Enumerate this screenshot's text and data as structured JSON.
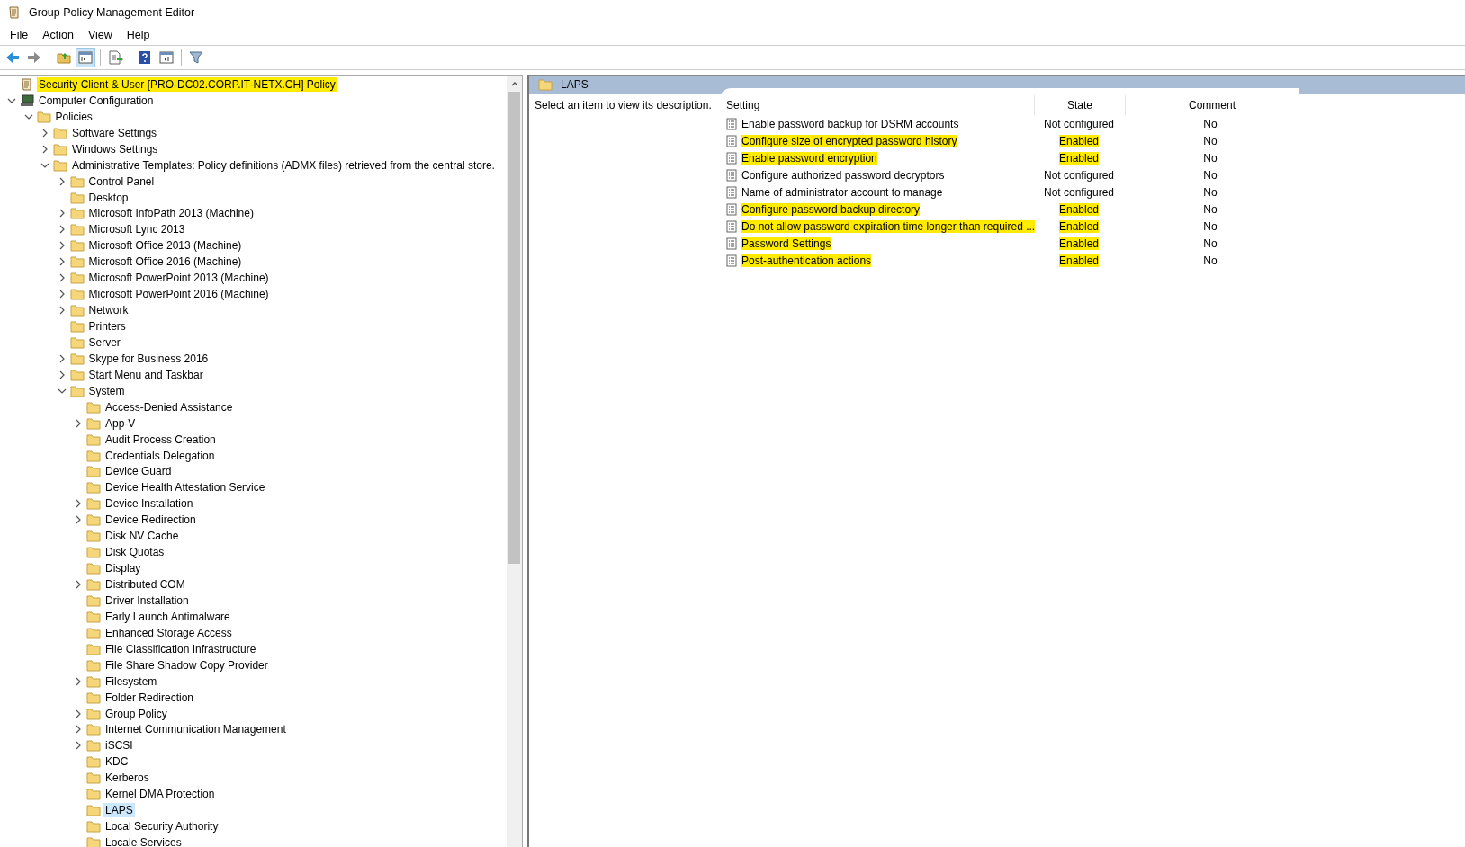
{
  "window": {
    "title": "Group Policy Management Editor"
  },
  "menu": [
    "File",
    "Action",
    "View",
    "Help"
  ],
  "toolbar": {
    "console_tree_pressed": true
  },
  "tree": [
    {
      "label": "Security Client & User [PRO-DC02.CORP.IT-NETX.CH] Policy",
      "kind": "policy",
      "highlighted": true,
      "selected": false
    },
    {
      "label": "Computer Configuration",
      "kind": "computer",
      "highlighted": false,
      "selected": false,
      "expanded": true,
      "children": [
        {
          "label": "Policies",
          "kind": "folder",
          "highlighted": false,
          "selected": false,
          "expanded": true,
          "children": [
            {
              "label": "Software Settings",
              "kind": "folder",
              "highlighted": false,
              "selected": false,
              "expanded": false
            },
            {
              "label": "Windows Settings",
              "kind": "folder",
              "highlighted": false,
              "selected": false,
              "expanded": false
            },
            {
              "label": "Administrative Templates: Policy definitions (ADMX files) retrieved from the central store.",
              "kind": "folder",
              "highlighted": false,
              "selected": false,
              "expanded": true,
              "children": [
                {
                  "label": "Control Panel",
                  "kind": "folder",
                  "highlighted": false,
                  "selected": false,
                  "expanded": false
                },
                {
                  "label": "Desktop",
                  "kind": "folder",
                  "highlighted": false,
                  "selected": false
                },
                {
                  "label": "Microsoft InfoPath 2013 (Machine)",
                  "kind": "folder",
                  "highlighted": false,
                  "selected": false,
                  "expanded": false
                },
                {
                  "label": "Microsoft Lync 2013",
                  "kind": "folder",
                  "highlighted": false,
                  "selected": false,
                  "expanded": false
                },
                {
                  "label": "Microsoft Office 2013 (Machine)",
                  "kind": "folder",
                  "highlighted": false,
                  "selected": false,
                  "expanded": false
                },
                {
                  "label": "Microsoft Office 2016 (Machine)",
                  "kind": "folder",
                  "highlighted": false,
                  "selected": false,
                  "expanded": false
                },
                {
                  "label": "Microsoft PowerPoint 2013 (Machine)",
                  "kind": "folder",
                  "highlighted": false,
                  "selected": false,
                  "expanded": false
                },
                {
                  "label": "Microsoft PowerPoint 2016 (Machine)",
                  "kind": "folder",
                  "highlighted": false,
                  "selected": false,
                  "expanded": false
                },
                {
                  "label": "Network",
                  "kind": "folder",
                  "highlighted": false,
                  "selected": false,
                  "expanded": false
                },
                {
                  "label": "Printers",
                  "kind": "folder",
                  "highlighted": false,
                  "selected": false
                },
                {
                  "label": "Server",
                  "kind": "folder",
                  "highlighted": false,
                  "selected": false
                },
                {
                  "label": "Skype for Business 2016",
                  "kind": "folder",
                  "highlighted": false,
                  "selected": false,
                  "expanded": false
                },
                {
                  "label": "Start Menu and Taskbar",
                  "kind": "folder",
                  "highlighted": false,
                  "selected": false,
                  "expanded": false
                },
                {
                  "label": "System",
                  "kind": "folder",
                  "highlighted": false,
                  "selected": false,
                  "expanded": true,
                  "children": [
                    {
                      "label": "Access-Denied Assistance",
                      "kind": "folder",
                      "highlighted": false,
                      "selected": false
                    },
                    {
                      "label": "App-V",
                      "kind": "folder",
                      "highlighted": false,
                      "selected": false,
                      "expanded": false
                    },
                    {
                      "label": "Audit Process Creation",
                      "kind": "folder",
                      "highlighted": false,
                      "selected": false
                    },
                    {
                      "label": "Credentials Delegation",
                      "kind": "folder",
                      "highlighted": false,
                      "selected": false
                    },
                    {
                      "label": "Device Guard",
                      "kind": "folder",
                      "highlighted": false,
                      "selected": false
                    },
                    {
                      "label": "Device Health Attestation Service",
                      "kind": "folder",
                      "highlighted": false,
                      "selected": false
                    },
                    {
                      "label": "Device Installation",
                      "kind": "folder",
                      "highlighted": false,
                      "selected": false,
                      "expanded": false
                    },
                    {
                      "label": "Device Redirection",
                      "kind": "folder",
                      "highlighted": false,
                      "selected": false,
                      "expanded": false
                    },
                    {
                      "label": "Disk NV Cache",
                      "kind": "folder",
                      "highlighted": false,
                      "selected": false
                    },
                    {
                      "label": "Disk Quotas",
                      "kind": "folder",
                      "highlighted": false,
                      "selected": false
                    },
                    {
                      "label": "Display",
                      "kind": "folder",
                      "highlighted": false,
                      "selected": false
                    },
                    {
                      "label": "Distributed COM",
                      "kind": "folder",
                      "highlighted": false,
                      "selected": false,
                      "expanded": false
                    },
                    {
                      "label": "Driver Installation",
                      "kind": "folder",
                      "highlighted": false,
                      "selected": false
                    },
                    {
                      "label": "Early Launch Antimalware",
                      "kind": "folder",
                      "highlighted": false,
                      "selected": false
                    },
                    {
                      "label": "Enhanced Storage Access",
                      "kind": "folder",
                      "highlighted": false,
                      "selected": false
                    },
                    {
                      "label": "File Classification Infrastructure",
                      "kind": "folder",
                      "highlighted": false,
                      "selected": false
                    },
                    {
                      "label": "File Share Shadow Copy Provider",
                      "kind": "folder",
                      "highlighted": false,
                      "selected": false
                    },
                    {
                      "label": "Filesystem",
                      "kind": "folder",
                      "highlighted": false,
                      "selected": false,
                      "expanded": false
                    },
                    {
                      "label": "Folder Redirection",
                      "kind": "folder",
                      "highlighted": false,
                      "selected": false
                    },
                    {
                      "label": "Group Policy",
                      "kind": "folder",
                      "highlighted": false,
                      "selected": false,
                      "expanded": false
                    },
                    {
                      "label": "Internet Communication Management",
                      "kind": "folder",
                      "highlighted": false,
                      "selected": false,
                      "expanded": false
                    },
                    {
                      "label": "iSCSI",
                      "kind": "folder",
                      "highlighted": false,
                      "selected": false,
                      "expanded": false
                    },
                    {
                      "label": "KDC",
                      "kind": "folder",
                      "highlighted": false,
                      "selected": false
                    },
                    {
                      "label": "Kerberos",
                      "kind": "folder",
                      "highlighted": false,
                      "selected": false
                    },
                    {
                      "label": "Kernel DMA Protection",
                      "kind": "folder",
                      "highlighted": false,
                      "selected": false
                    },
                    {
                      "label": "LAPS",
                      "kind": "folder",
                      "highlighted": false,
                      "selected": true
                    },
                    {
                      "label": "Local Security Authority",
                      "kind": "folder",
                      "highlighted": false,
                      "selected": false
                    },
                    {
                      "label": "Locale Services",
                      "kind": "folder",
                      "highlighted": false,
                      "selected": false
                    }
                  ]
                }
              ]
            }
          ]
        }
      ]
    }
  ],
  "details": {
    "title": "LAPS",
    "description": "Select an item to view its description.",
    "columns": [
      "Setting",
      "State",
      "Comment"
    ],
    "rows": [
      {
        "setting": "Enable password backup for DSRM accounts",
        "state": "Not configured",
        "comment": "No",
        "highlighted": false
      },
      {
        "setting": "Configure size of encrypted password history",
        "state": "Enabled",
        "comment": "No",
        "highlighted": true
      },
      {
        "setting": "Enable password encryption",
        "state": "Enabled",
        "comment": "No",
        "highlighted": true
      },
      {
        "setting": "Configure authorized password decryptors",
        "state": "Not configured",
        "comment": "No",
        "highlighted": false
      },
      {
        "setting": "Name of administrator account to manage",
        "state": "Not configured",
        "comment": "No",
        "highlighted": false
      },
      {
        "setting": "Configure password backup directory",
        "state": "Enabled",
        "comment": "No",
        "highlighted": true
      },
      {
        "setting": "Do not allow password expiration time longer than required ...",
        "state": "Enabled",
        "comment": "No",
        "highlighted": true
      },
      {
        "setting": "Password Settings",
        "state": "Enabled",
        "comment": "No",
        "highlighted": true
      },
      {
        "setting": "Post-authentication actions",
        "state": "Enabled",
        "comment": "No",
        "highlighted": true
      }
    ]
  }
}
